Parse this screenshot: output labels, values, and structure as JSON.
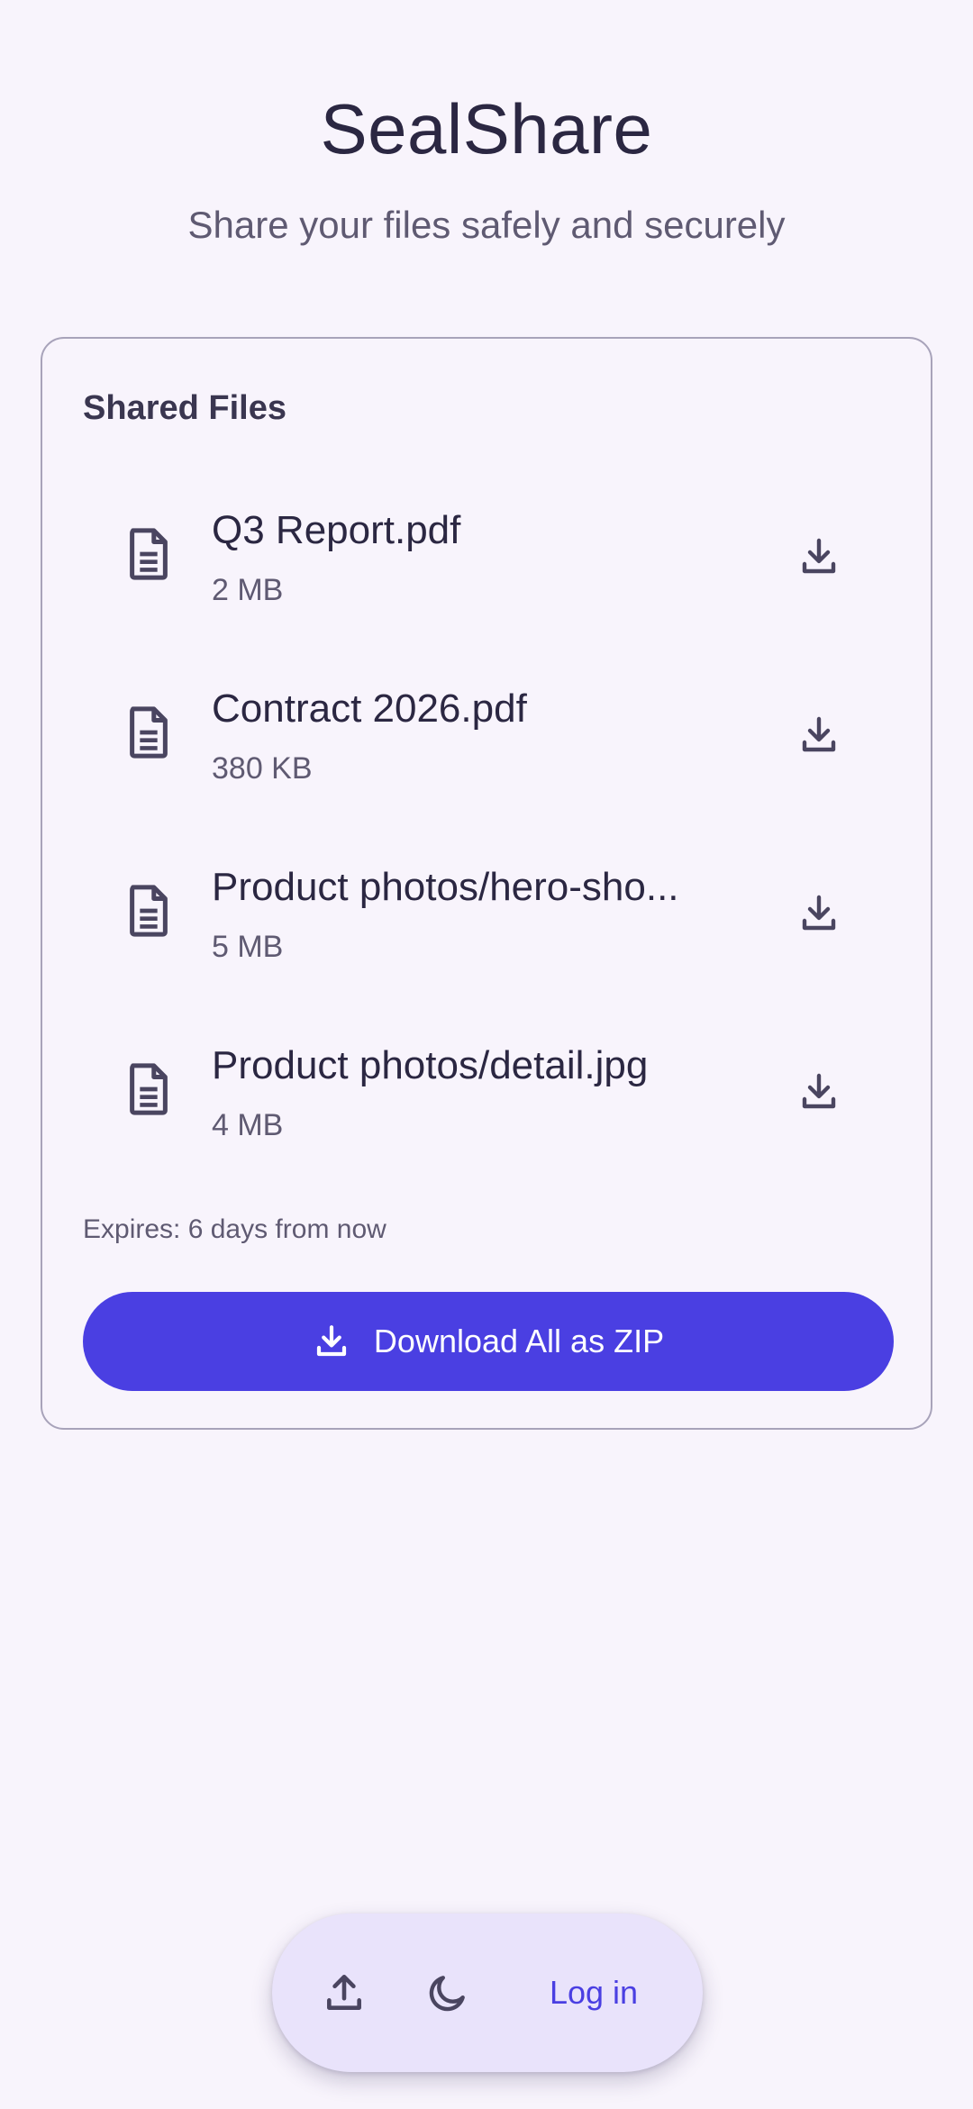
{
  "app": {
    "title": "SealShare",
    "subtitle": "Share your files safely and securely"
  },
  "card": {
    "title": "Shared Files",
    "files": [
      {
        "name": "Q3 Report.pdf",
        "size": "2 MB",
        "icon": "document-icon",
        "action_icon": "download-icon"
      },
      {
        "name": "Contract 2026.pdf",
        "size": "380 KB",
        "icon": "document-icon",
        "action_icon": "download-icon"
      },
      {
        "name": "Product photos/hero-sho...",
        "size": "5 MB",
        "icon": "document-icon",
        "action_icon": "download-icon"
      },
      {
        "name": "Product photos/detail.jpg",
        "size": "4 MB",
        "icon": "document-icon",
        "action_icon": "download-icon"
      }
    ],
    "expires": "Expires: 6 days from now",
    "download_all_label": "Download All as ZIP"
  },
  "bottom_bar": {
    "upload_icon": "upload-icon",
    "theme_icon": "moon-icon",
    "login_label": "Log in"
  },
  "colors": {
    "background": "#f8f4fc",
    "accent": "#4a3fe2",
    "card_border": "#a8a3ba",
    "bar_background": "#e9e3fb",
    "text_primary": "#2b2742",
    "text_secondary": "#5f5a72"
  }
}
